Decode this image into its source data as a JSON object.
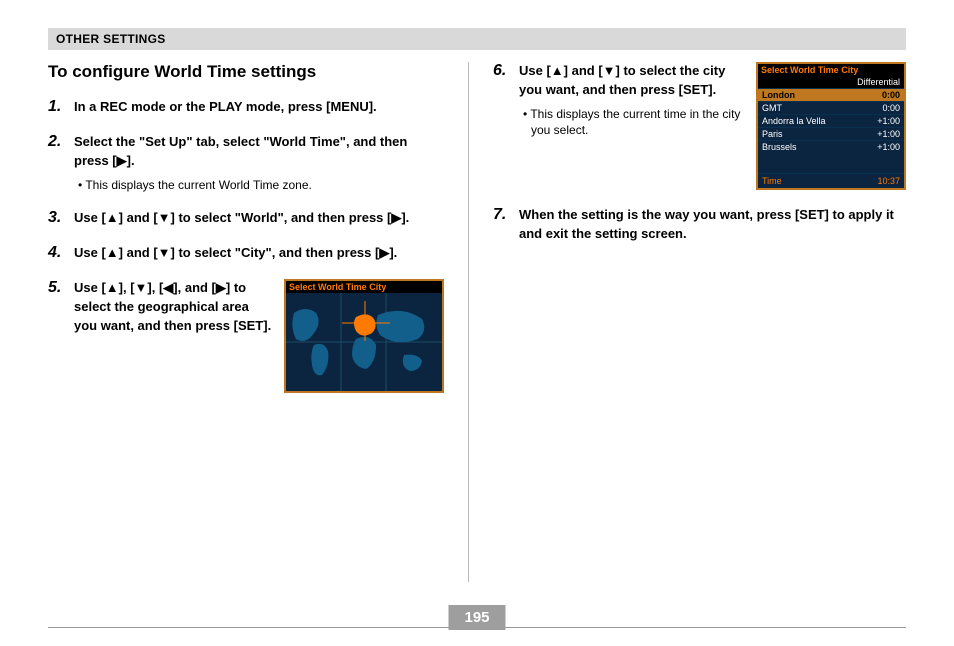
{
  "header": "OTHER SETTINGS",
  "title": "To configure World Time settings",
  "steps": [
    {
      "n": "1.",
      "main": "In a REC mode or the PLAY mode, press [MENU]."
    },
    {
      "n": "2.",
      "main": "Select the \"Set Up\" tab, select \"World Time\", and then press [▶].",
      "sub": "This displays the current World Time zone."
    },
    {
      "n": "3.",
      "main": "Use [▲] and [▼] to select \"World\", and then press [▶]."
    },
    {
      "n": "4.",
      "main": "Use [▲] and [▼] to select \"City\", and then press [▶]."
    },
    {
      "n": "5.",
      "main": "Use [▲], [▼], [◀], and [▶] to select the geographical area you want, and then press [SET]."
    },
    {
      "n": "6.",
      "main": "Use [▲] and [▼] to select the city you want, and then press [SET].",
      "sub": "This displays the current time in the city you select."
    },
    {
      "n": "7.",
      "main": "When the setting is the way you want, press [SET] to apply it and exit the setting screen."
    }
  ],
  "lcd_map": {
    "title": "Select World Time City"
  },
  "lcd_list": {
    "title": "Select World Time City",
    "header": "Differential",
    "rows": [
      {
        "city": "London",
        "diff": "0:00",
        "selected": true
      },
      {
        "city": "GMT",
        "diff": "0:00"
      },
      {
        "city": "Andorra la Vella",
        "diff": "+1:00"
      },
      {
        "city": "Paris",
        "diff": "+1:00"
      },
      {
        "city": "Brussels",
        "diff": "+1:00"
      }
    ],
    "footer_label": "Time",
    "footer_value": "10:37"
  },
  "page_number": "195"
}
